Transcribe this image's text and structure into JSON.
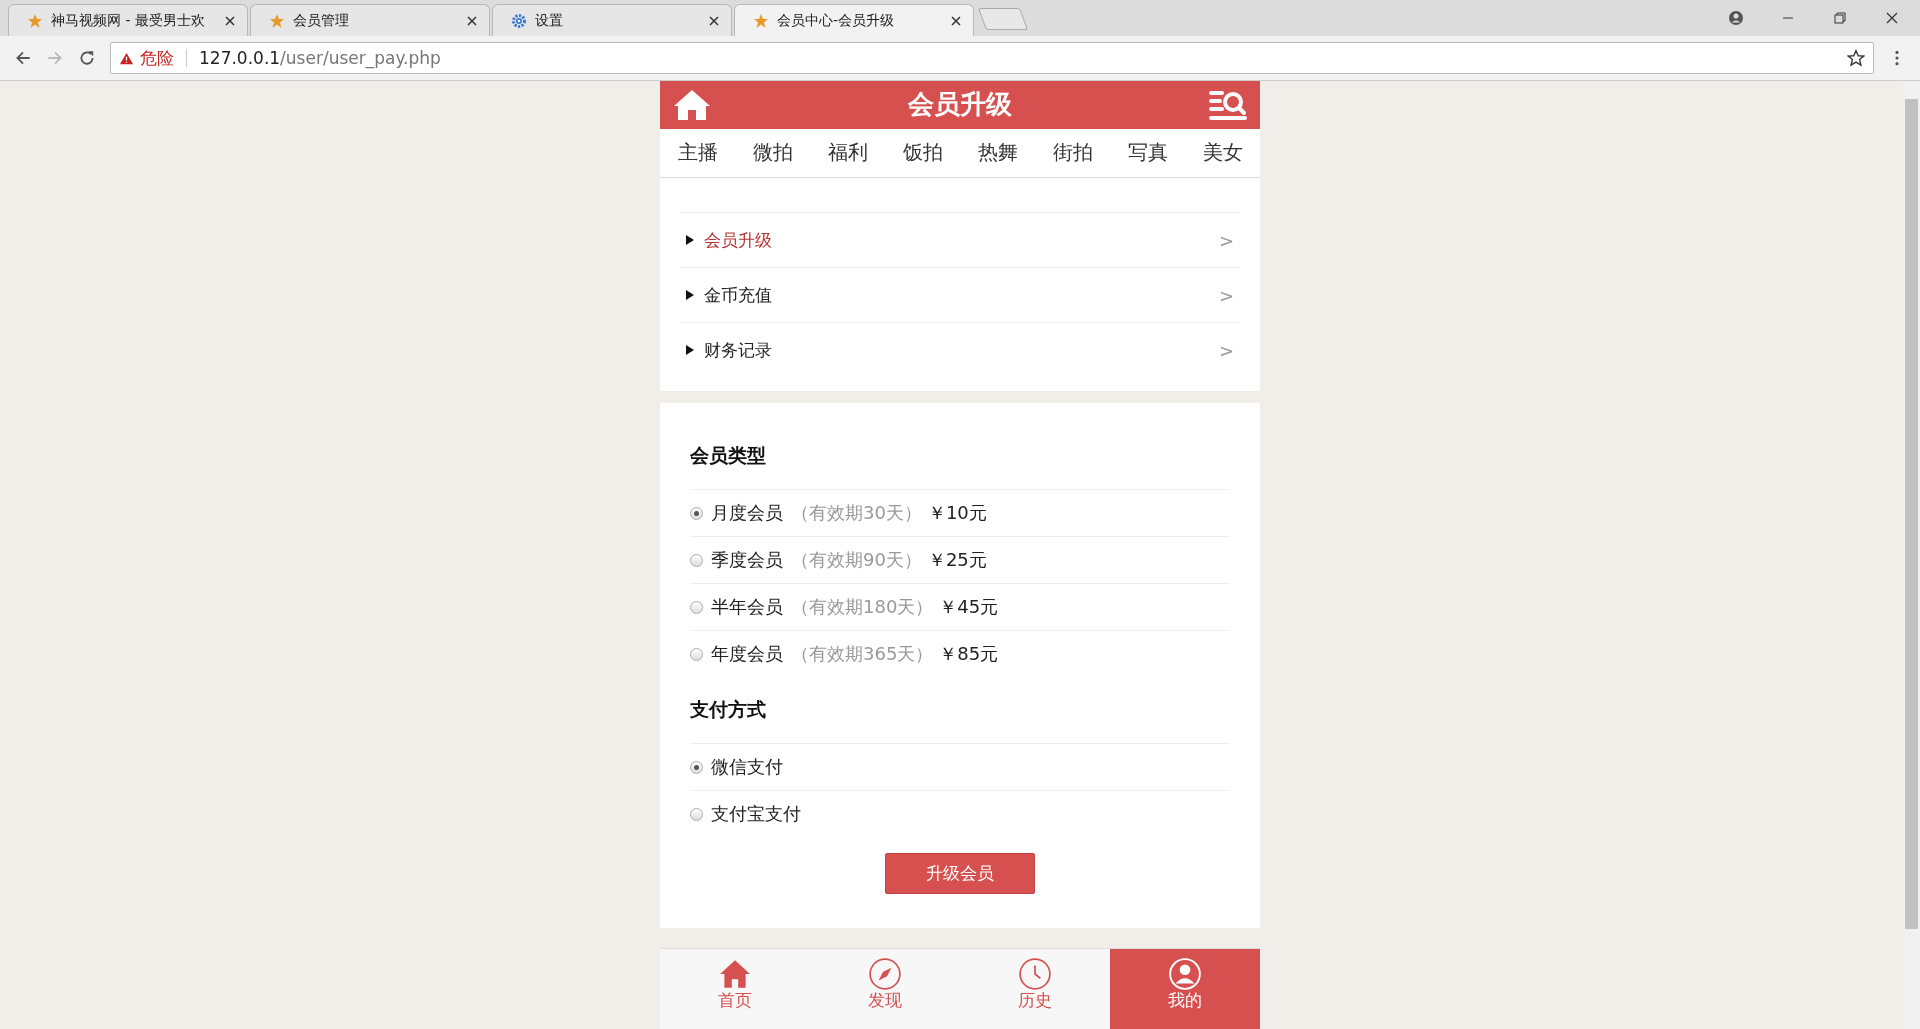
{
  "browser": {
    "tabs": [
      {
        "title": "神马视频网 - 最受男士欢",
        "kind": "site",
        "selected": false
      },
      {
        "title": "会员管理",
        "kind": "site",
        "selected": false
      },
      {
        "title": "设置",
        "kind": "settings",
        "selected": false
      },
      {
        "title": "会员中心-会员升级",
        "kind": "site",
        "selected": true
      }
    ],
    "security": "危险",
    "url_host": "127.0.0.1",
    "url_path": "/user/user_pay.php"
  },
  "header": {
    "title": "会员升级"
  },
  "categories": [
    "主播",
    "微拍",
    "福利",
    "饭拍",
    "热舞",
    "街拍",
    "写真",
    "美女"
  ],
  "menu": [
    {
      "label": "会员升级",
      "selected": true,
      "arrow": ">"
    },
    {
      "label": "金币充值",
      "selected": false,
      "arrow": ">"
    },
    {
      "label": "财务记录",
      "selected": false,
      "arrow": ">"
    }
  ],
  "membership": {
    "heading": "会员类型",
    "options": [
      {
        "name": "月度会员",
        "validity": "（有效期30天）",
        "price": "￥10元",
        "selected": true
      },
      {
        "name": "季度会员",
        "validity": "（有效期90天）",
        "price": "￥25元",
        "selected": false
      },
      {
        "name": "半年会员",
        "validity": "（有效期180天）",
        "price": "￥45元",
        "selected": false
      },
      {
        "name": "年度会员",
        "validity": "（有效期365天）",
        "price": "￥85元",
        "selected": false
      }
    ]
  },
  "payment": {
    "heading": "支付方式",
    "options": [
      {
        "name": "微信支付",
        "selected": true
      },
      {
        "name": "支付宝支付",
        "selected": false
      }
    ]
  },
  "submit": "升级会员",
  "bottom_nav": [
    {
      "label": "首页",
      "kind": "home",
      "selected": false
    },
    {
      "label": "发现",
      "kind": "discover",
      "selected": false
    },
    {
      "label": "历史",
      "kind": "history",
      "selected": false
    },
    {
      "label": "我的",
      "kind": "profile",
      "selected": true
    }
  ]
}
